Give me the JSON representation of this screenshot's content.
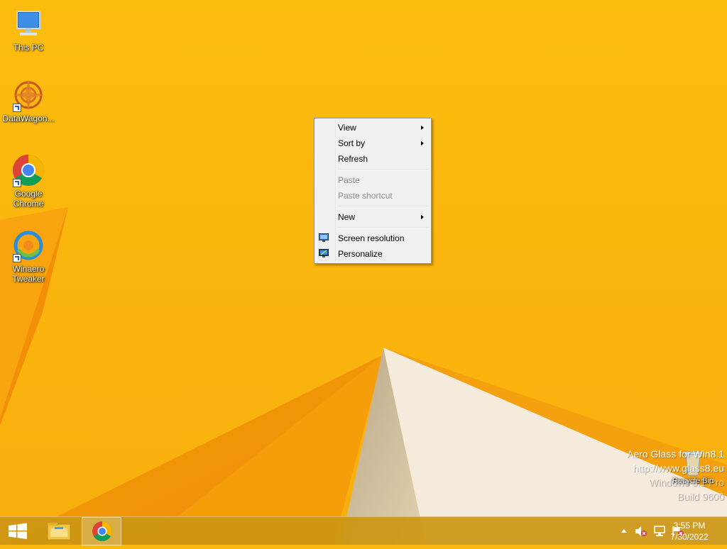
{
  "desktop": {
    "icons": [
      {
        "label": "This PC"
      },
      {
        "label": "DataWagon..."
      },
      {
        "label": "Google Chrome"
      },
      {
        "label": "Winaero Tweaker"
      }
    ],
    "recycle_bin": {
      "label": "Recycle Bin"
    }
  },
  "context_menu": {
    "items": [
      {
        "label": "View",
        "submenu": true,
        "enabled": true
      },
      {
        "label": "Sort by",
        "submenu": true,
        "enabled": true
      },
      {
        "label": "Refresh",
        "enabled": true
      },
      {
        "label": "Paste",
        "enabled": false
      },
      {
        "label": "Paste shortcut",
        "enabled": false
      },
      {
        "label": "New",
        "submenu": true,
        "enabled": true
      },
      {
        "label": "Screen resolution",
        "icon": "monitor-icon",
        "enabled": true
      },
      {
        "label": "Personalize",
        "icon": "personalize-icon",
        "enabled": true
      }
    ]
  },
  "watermark": {
    "line1": "Aero Glass for Win8.1",
    "line2": "http://www.glass8.eu",
    "line3": "Windows 8.1 Pro",
    "line4": "Build 9600"
  },
  "taskbar": {
    "start_icon": "windows-logo-icon",
    "pinned": [
      {
        "icon": "file-explorer-icon"
      },
      {
        "icon": "chrome-icon",
        "active": true
      }
    ],
    "tray": {
      "icons": [
        "show-hidden-icons-chevron",
        "volume-muted-icon",
        "network-icon",
        "action-center-flag-icon"
      ],
      "time": "3:55 PM",
      "date": "7/30/2022"
    }
  },
  "colors": {
    "wallpaper": "#FCBA0E",
    "wallpaper_dark": "#F28A06",
    "wallpaper_light": "#F4E8D6",
    "menu_bg": "#F1F1F1",
    "menu_disabled_text": "#8d8d8d"
  }
}
